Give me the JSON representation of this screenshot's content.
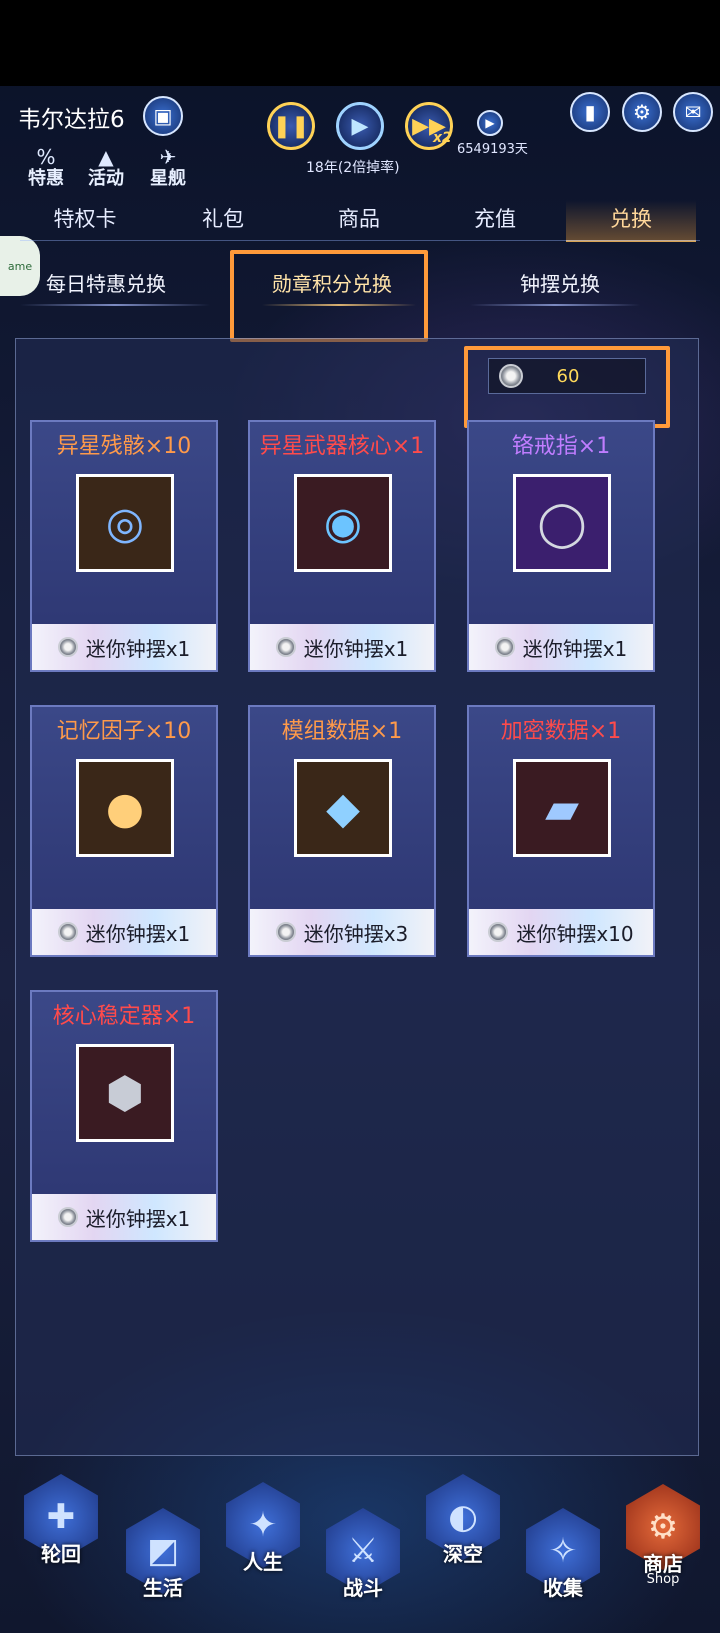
{
  "header": {
    "player_name": "韦尔达拉6",
    "game_time": "18年(2倍掉率)",
    "days": "6549193天",
    "speed_badge": "x2"
  },
  "quick_links": [
    {
      "label": "特惠",
      "icon": "discount-icon"
    },
    {
      "label": "活动",
      "icon": "activity-icon"
    },
    {
      "label": "星舰",
      "icon": "starship-icon"
    }
  ],
  "side_badge": {
    "label": "ame"
  },
  "tabs": [
    {
      "label": "特权卡"
    },
    {
      "label": "礼包"
    },
    {
      "label": "商品"
    },
    {
      "label": "充值"
    },
    {
      "label": "兑换",
      "active": true
    }
  ],
  "subtabs": [
    {
      "label": "每日特惠兑换"
    },
    {
      "label": "勋章积分兑换",
      "active": true
    },
    {
      "label": "钟摆兑换"
    }
  ],
  "balance": {
    "value": "60",
    "icon": "mini-pendulum-coin-icon"
  },
  "items": [
    {
      "name": "异星残骸×10",
      "cost": "迷你钟摆x1",
      "rarity_color": "orange",
      "icon": "alien-wreckage-icon"
    },
    {
      "name": "异星武器核心×1",
      "cost": "迷你钟摆x1",
      "rarity_color": "red",
      "icon": "alien-weapon-core-icon"
    },
    {
      "name": "铬戒指×1",
      "cost": "迷你钟摆x1",
      "rarity_color": "purple",
      "icon": "chrome-ring-icon"
    },
    {
      "name": "记忆因子×10",
      "cost": "迷你钟摆x1",
      "rarity_color": "orange",
      "icon": "memory-factor-icon"
    },
    {
      "name": "模组数据×1",
      "cost": "迷你钟摆x3",
      "rarity_color": "orange",
      "icon": "module-data-icon"
    },
    {
      "name": "加密数据×1",
      "cost": "迷你钟摆x10",
      "rarity_color": "red",
      "icon": "encrypted-data-icon"
    },
    {
      "name": "核心稳定器×1",
      "cost": "迷你钟摆x1",
      "rarity_color": "red",
      "icon": "core-stabilizer-icon"
    }
  ],
  "nav": [
    {
      "label": "轮回",
      "icon": "reincarnation-icon"
    },
    {
      "label": "生活",
      "icon": "life-icon"
    },
    {
      "label": "人生",
      "icon": "career-icon"
    },
    {
      "label": "战斗",
      "icon": "battle-icon"
    },
    {
      "label": "深空",
      "icon": "deep-space-icon"
    },
    {
      "label": "收集",
      "icon": "collection-icon"
    },
    {
      "label": "商店",
      "sub": "Shop",
      "icon": "shop-icon",
      "active": true
    }
  ],
  "colors": {
    "highlight": "#ff9a3a",
    "gold": "#ffd256",
    "orange": "#ff9a4a",
    "red": "#ff4b4b",
    "purple": "#c07dff"
  }
}
